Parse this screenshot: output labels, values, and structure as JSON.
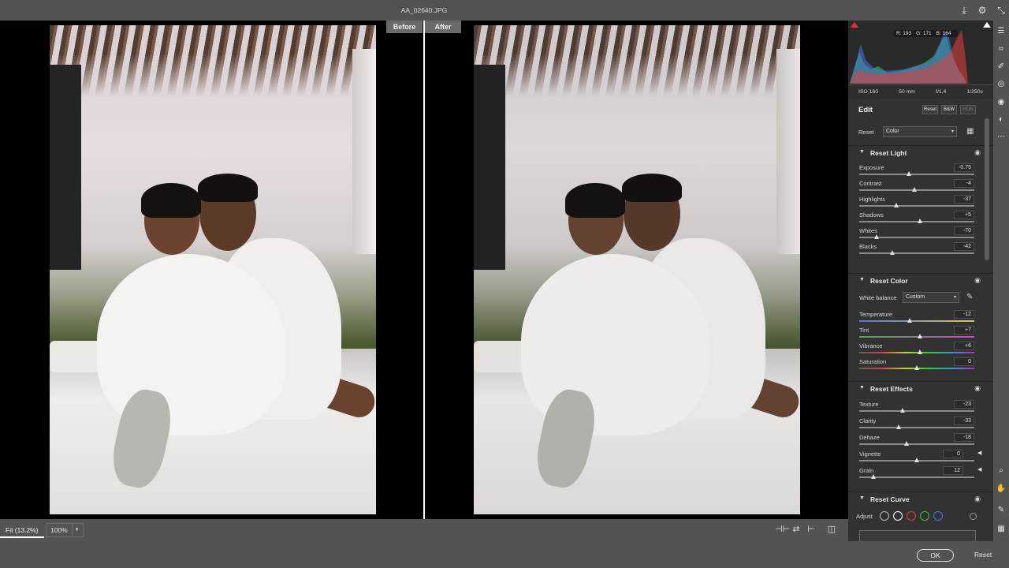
{
  "window": {
    "title": "AA_02640.JPG"
  },
  "compare": {
    "before_label": "Before",
    "after_label": "After"
  },
  "histogram": {
    "r_label": "R: 193",
    "g_label": "G: 171",
    "b_label": "B: 164"
  },
  "exif": {
    "iso": "ISO 160",
    "focal": "50 mm",
    "aperture": "f/1.4",
    "shutter": "1/250s"
  },
  "edit": {
    "title": "Edit",
    "reset_btn": "Reset",
    "bw_btn": "B&W",
    "hdr_btn": "HDR"
  },
  "profile": {
    "label": "Reset",
    "value": "Color"
  },
  "light": {
    "title": "Reset Light",
    "sliders": [
      {
        "label": "Exposure",
        "value": "-0.75",
        "pos": 0.43
      },
      {
        "label": "Contrast",
        "value": "-4",
        "pos": 0.48
      },
      {
        "label": "Highlights",
        "value": "-37",
        "pos": 0.32
      },
      {
        "label": "Shadows",
        "value": "+5",
        "pos": 0.53
      },
      {
        "label": "Whites",
        "value": "-70",
        "pos": 0.15
      },
      {
        "label": "Blacks",
        "value": "-42",
        "pos": 0.29
      }
    ]
  },
  "color": {
    "title": "Reset Color",
    "wb_label": "White balance",
    "wb_value": "Custom",
    "sliders": [
      {
        "label": "Temperature",
        "value": "-12",
        "pos": 0.44,
        "track": "temp"
      },
      {
        "label": "Tint",
        "value": "+7",
        "pos": 0.53,
        "track": "tint"
      },
      {
        "label": "Vibrance",
        "value": "+6",
        "pos": 0.53,
        "track": "vib"
      },
      {
        "label": "Saturation",
        "value": "0",
        "pos": 0.5,
        "track": "sat"
      }
    ]
  },
  "effects": {
    "title": "Reset Effects",
    "sliders": [
      {
        "label": "Texture",
        "value": "-23",
        "pos": 0.38
      },
      {
        "label": "Clarity",
        "value": "-33",
        "pos": 0.34
      },
      {
        "label": "Dehaze",
        "value": "-18",
        "pos": 0.41
      },
      {
        "label": "Vignette",
        "value": "0",
        "pos": 0.5,
        "arrow": true
      },
      {
        "label": "Grain",
        "value": "12",
        "pos": 0.12,
        "arrow": true
      }
    ]
  },
  "curve": {
    "title": "Reset Curve",
    "adjust_label": "Adjust"
  },
  "zoom": {
    "fit_label": "Fit (13.2%)",
    "level": "100%"
  },
  "footer": {
    "ok_label": "OK",
    "reset_label": "Reset"
  },
  "colors": {
    "panel_bg": "#323232",
    "chrome_bg": "#535353",
    "canvas_bg": "#000000"
  }
}
